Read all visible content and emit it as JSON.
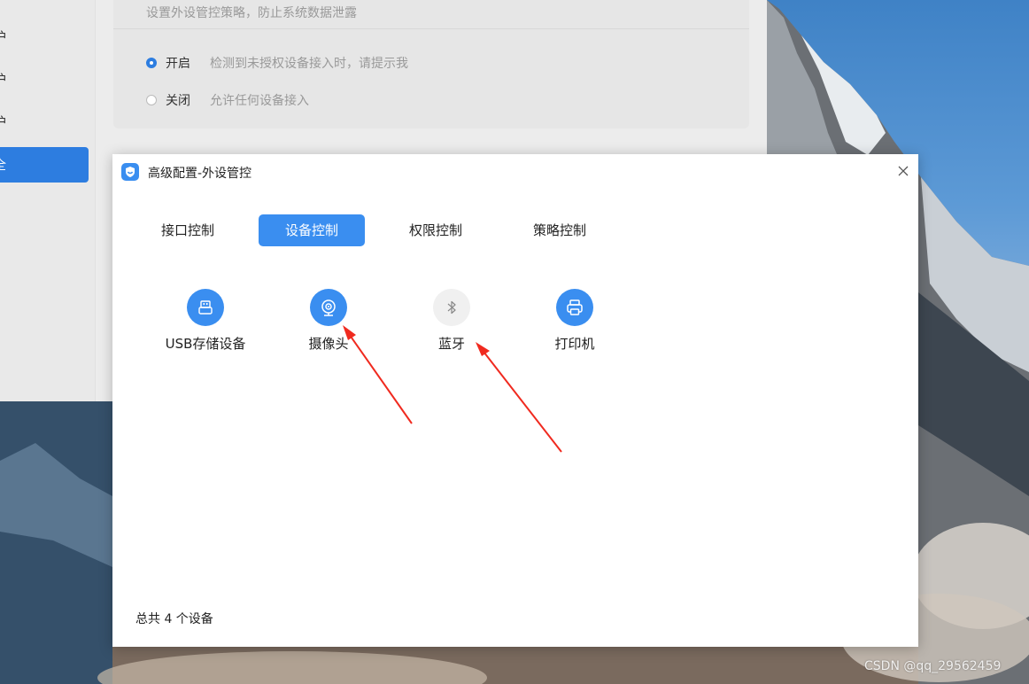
{
  "background_window": {
    "sidebar_items": [
      {
        "label": "护"
      },
      {
        "label": "护"
      },
      {
        "label": "护"
      },
      {
        "label": "全"
      }
    ],
    "card_description": "设置外设管控策略，防止系统数据泄露",
    "options": [
      {
        "label": "开启",
        "description": "检测到未授权设备接入时，请提示我",
        "checked": true
      },
      {
        "label": "关闭",
        "description": "允许任何设备接入",
        "checked": false
      }
    ]
  },
  "dialog": {
    "title": "高级配置-外设管控",
    "tabs": [
      {
        "label": "接口控制",
        "active": false
      },
      {
        "label": "设备控制",
        "active": true
      },
      {
        "label": "权限控制",
        "active": false
      },
      {
        "label": "策略控制",
        "active": false
      }
    ],
    "devices": [
      {
        "label": "USB存储设备",
        "icon": "usb-icon",
        "enabled": true
      },
      {
        "label": "摄像头",
        "icon": "camera-icon",
        "enabled": true
      },
      {
        "label": "蓝牙",
        "icon": "bluetooth-icon",
        "enabled": false
      },
      {
        "label": "打印机",
        "icon": "printer-icon",
        "enabled": true
      }
    ],
    "footer_count": "总共 4 个设备"
  },
  "colors": {
    "accent": "#3a8ef0",
    "sidebar_active": "#2d7de0",
    "annotation_arrow": "#f02a1f"
  },
  "watermark": "CSDN @qq_29562459"
}
